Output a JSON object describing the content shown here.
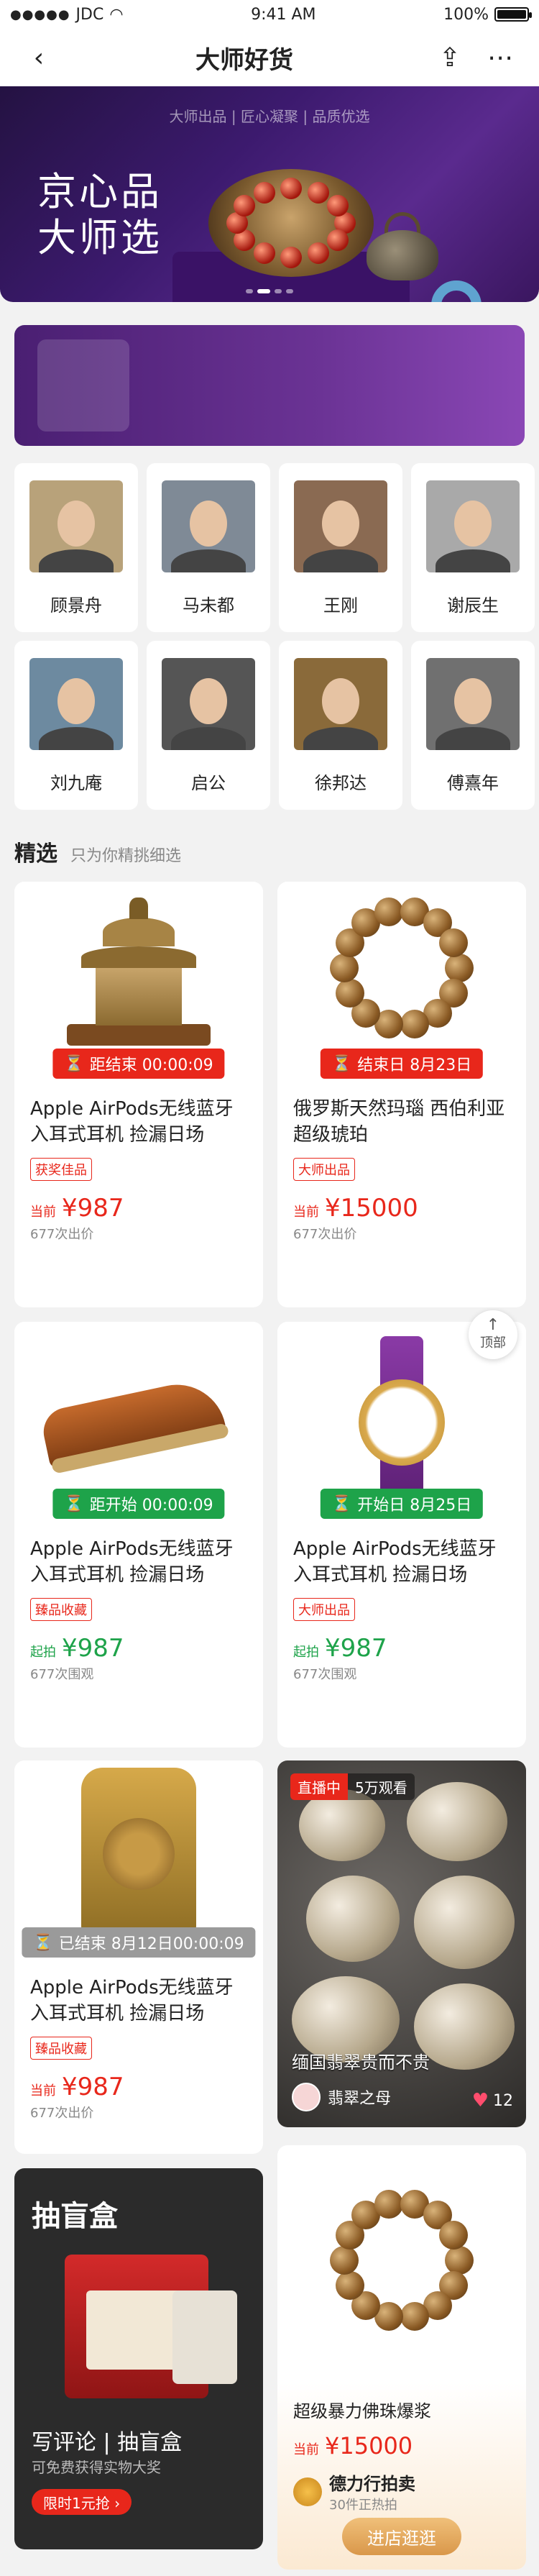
{
  "status": {
    "carrier": "JDC",
    "time": "9:41 AM",
    "battery": "100%"
  },
  "nav": {
    "title": "大师好货"
  },
  "hero": {
    "tags": "大师出品 | 匠心凝聚 | 品质优选",
    "slogan_line1": "京心品",
    "slogan_line2": "大师选",
    "slides": 4,
    "active_slide": 2
  },
  "masters": [
    {
      "name": "顾景舟"
    },
    {
      "name": "马未都"
    },
    {
      "name": "王刚"
    },
    {
      "name": "谢辰生"
    },
    {
      "name": "刘九庵"
    },
    {
      "name": "启公"
    },
    {
      "name": "徐邦达"
    },
    {
      "name": "傅熹年"
    }
  ],
  "section": {
    "title": "精选",
    "subtitle": "只为你精挑细选"
  },
  "products": [
    {
      "badge": "距结束 00:00:09",
      "title": "Apple AirPods无线蓝牙入耳式耳机 捡漏日场",
      "tag": "获奖佳品",
      "price_label": "当前",
      "price": "¥987",
      "count": "677次出价"
    },
    {
      "badge": "结束日 8月23日",
      "title": "俄罗斯天然玛瑙 西伯利亚超级琥珀",
      "tag": "大师出品",
      "price_label": "当前",
      "price": "¥15000",
      "count": "677次出价"
    },
    {
      "badge": "距开始 00:00:09",
      "title": "Apple AirPods无线蓝牙入耳式耳机 捡漏日场",
      "tag": "臻品收藏",
      "price_label": "起拍",
      "price": "¥987",
      "count": "677次围观"
    },
    {
      "badge": "开始日 8月25日",
      "title": "Apple AirPods无线蓝牙入耳式耳机 捡漏日场",
      "tag": "大师出品",
      "price_label": "起拍",
      "price": "¥987",
      "count": "677次围观"
    },
    {
      "badge": "已结束 8月12日00:00:09",
      "title": "Apple AirPods无线蓝牙入耳式耳机 捡漏日场",
      "tag": "臻品收藏",
      "price_label": "当前",
      "price": "¥987",
      "count": "677次出价"
    }
  ],
  "live": {
    "status": "直播中",
    "viewers": "5万观看",
    "caption": "缅国翡翠贵而不贵",
    "host": "翡翠之母",
    "likes": "12"
  },
  "blind_box": {
    "title": "抽盲盒",
    "line1": "写评论 | 抽盲盒",
    "line2": "可免费获得实物大奖",
    "cta": "限时1元抢 ›"
  },
  "promo": {
    "title": "超级暴力佛珠爆浆",
    "price_label": "当前",
    "price": "¥15000",
    "seller": "德力行拍卖",
    "seller_sub": "30件正热拍",
    "cta": "进店逛逛"
  },
  "back_to_top": "顶部",
  "colors": {
    "accent_red": "#e8271b",
    "accent_green": "#1ea34a",
    "hero_purple": "#3c1a6e"
  }
}
